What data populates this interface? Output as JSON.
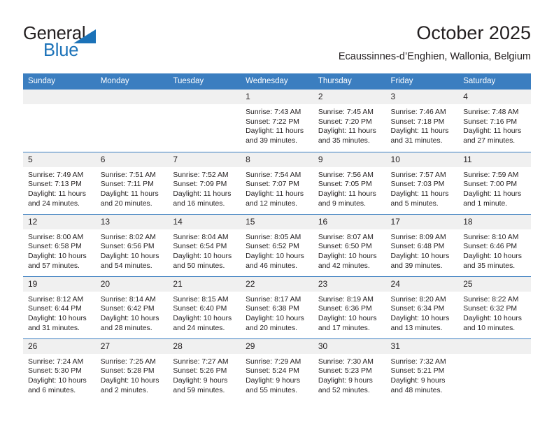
{
  "brand": {
    "name_part1": "General",
    "name_part2": "Blue",
    "triangle_icon": "triangle-icon",
    "accent_color": "#1b72b8"
  },
  "header": {
    "title": "October 2025",
    "subtitle": "Ecaussinnes-d’Enghien, Wallonia, Belgium"
  },
  "calendar": {
    "header_color": "#3b7ec0",
    "weekday_headers": [
      "Sunday",
      "Monday",
      "Tuesday",
      "Wednesday",
      "Thursday",
      "Friday",
      "Saturday"
    ],
    "weeks": [
      [
        {
          "day": "",
          "empty": true
        },
        {
          "day": "",
          "empty": true
        },
        {
          "day": "",
          "empty": true
        },
        {
          "day": "1",
          "sunrise": "Sunrise: 7:43 AM",
          "sunset": "Sunset: 7:22 PM",
          "daylight": "Daylight: 11 hours and 39 minutes."
        },
        {
          "day": "2",
          "sunrise": "Sunrise: 7:45 AM",
          "sunset": "Sunset: 7:20 PM",
          "daylight": "Daylight: 11 hours and 35 minutes."
        },
        {
          "day": "3",
          "sunrise": "Sunrise: 7:46 AM",
          "sunset": "Sunset: 7:18 PM",
          "daylight": "Daylight: 11 hours and 31 minutes."
        },
        {
          "day": "4",
          "sunrise": "Sunrise: 7:48 AM",
          "sunset": "Sunset: 7:16 PM",
          "daylight": "Daylight: 11 hours and 27 minutes."
        }
      ],
      [
        {
          "day": "5",
          "sunrise": "Sunrise: 7:49 AM",
          "sunset": "Sunset: 7:13 PM",
          "daylight": "Daylight: 11 hours and 24 minutes."
        },
        {
          "day": "6",
          "sunrise": "Sunrise: 7:51 AM",
          "sunset": "Sunset: 7:11 PM",
          "daylight": "Daylight: 11 hours and 20 minutes."
        },
        {
          "day": "7",
          "sunrise": "Sunrise: 7:52 AM",
          "sunset": "Sunset: 7:09 PM",
          "daylight": "Daylight: 11 hours and 16 minutes."
        },
        {
          "day": "8",
          "sunrise": "Sunrise: 7:54 AM",
          "sunset": "Sunset: 7:07 PM",
          "daylight": "Daylight: 11 hours and 12 minutes."
        },
        {
          "day": "9",
          "sunrise": "Sunrise: 7:56 AM",
          "sunset": "Sunset: 7:05 PM",
          "daylight": "Daylight: 11 hours and 9 minutes."
        },
        {
          "day": "10",
          "sunrise": "Sunrise: 7:57 AM",
          "sunset": "Sunset: 7:03 PM",
          "daylight": "Daylight: 11 hours and 5 minutes."
        },
        {
          "day": "11",
          "sunrise": "Sunrise: 7:59 AM",
          "sunset": "Sunset: 7:00 PM",
          "daylight": "Daylight: 11 hours and 1 minute."
        }
      ],
      [
        {
          "day": "12",
          "sunrise": "Sunrise: 8:00 AM",
          "sunset": "Sunset: 6:58 PM",
          "daylight": "Daylight: 10 hours and 57 minutes."
        },
        {
          "day": "13",
          "sunrise": "Sunrise: 8:02 AM",
          "sunset": "Sunset: 6:56 PM",
          "daylight": "Daylight: 10 hours and 54 minutes."
        },
        {
          "day": "14",
          "sunrise": "Sunrise: 8:04 AM",
          "sunset": "Sunset: 6:54 PM",
          "daylight": "Daylight: 10 hours and 50 minutes."
        },
        {
          "day": "15",
          "sunrise": "Sunrise: 8:05 AM",
          "sunset": "Sunset: 6:52 PM",
          "daylight": "Daylight: 10 hours and 46 minutes."
        },
        {
          "day": "16",
          "sunrise": "Sunrise: 8:07 AM",
          "sunset": "Sunset: 6:50 PM",
          "daylight": "Daylight: 10 hours and 42 minutes."
        },
        {
          "day": "17",
          "sunrise": "Sunrise: 8:09 AM",
          "sunset": "Sunset: 6:48 PM",
          "daylight": "Daylight: 10 hours and 39 minutes."
        },
        {
          "day": "18",
          "sunrise": "Sunrise: 8:10 AM",
          "sunset": "Sunset: 6:46 PM",
          "daylight": "Daylight: 10 hours and 35 minutes."
        }
      ],
      [
        {
          "day": "19",
          "sunrise": "Sunrise: 8:12 AM",
          "sunset": "Sunset: 6:44 PM",
          "daylight": "Daylight: 10 hours and 31 minutes."
        },
        {
          "day": "20",
          "sunrise": "Sunrise: 8:14 AM",
          "sunset": "Sunset: 6:42 PM",
          "daylight": "Daylight: 10 hours and 28 minutes."
        },
        {
          "day": "21",
          "sunrise": "Sunrise: 8:15 AM",
          "sunset": "Sunset: 6:40 PM",
          "daylight": "Daylight: 10 hours and 24 minutes."
        },
        {
          "day": "22",
          "sunrise": "Sunrise: 8:17 AM",
          "sunset": "Sunset: 6:38 PM",
          "daylight": "Daylight: 10 hours and 20 minutes."
        },
        {
          "day": "23",
          "sunrise": "Sunrise: 8:19 AM",
          "sunset": "Sunset: 6:36 PM",
          "daylight": "Daylight: 10 hours and 17 minutes."
        },
        {
          "day": "24",
          "sunrise": "Sunrise: 8:20 AM",
          "sunset": "Sunset: 6:34 PM",
          "daylight": "Daylight: 10 hours and 13 minutes."
        },
        {
          "day": "25",
          "sunrise": "Sunrise: 8:22 AM",
          "sunset": "Sunset: 6:32 PM",
          "daylight": "Daylight: 10 hours and 10 minutes."
        }
      ],
      [
        {
          "day": "26",
          "sunrise": "Sunrise: 7:24 AM",
          "sunset": "Sunset: 5:30 PM",
          "daylight": "Daylight: 10 hours and 6 minutes."
        },
        {
          "day": "27",
          "sunrise": "Sunrise: 7:25 AM",
          "sunset": "Sunset: 5:28 PM",
          "daylight": "Daylight: 10 hours and 2 minutes."
        },
        {
          "day": "28",
          "sunrise": "Sunrise: 7:27 AM",
          "sunset": "Sunset: 5:26 PM",
          "daylight": "Daylight: 9 hours and 59 minutes."
        },
        {
          "day": "29",
          "sunrise": "Sunrise: 7:29 AM",
          "sunset": "Sunset: 5:24 PM",
          "daylight": "Daylight: 9 hours and 55 minutes."
        },
        {
          "day": "30",
          "sunrise": "Sunrise: 7:30 AM",
          "sunset": "Sunset: 5:23 PM",
          "daylight": "Daylight: 9 hours and 52 minutes."
        },
        {
          "day": "31",
          "sunrise": "Sunrise: 7:32 AM",
          "sunset": "Sunset: 5:21 PM",
          "daylight": "Daylight: 9 hours and 48 minutes."
        },
        {
          "day": "",
          "empty": true
        }
      ]
    ]
  }
}
